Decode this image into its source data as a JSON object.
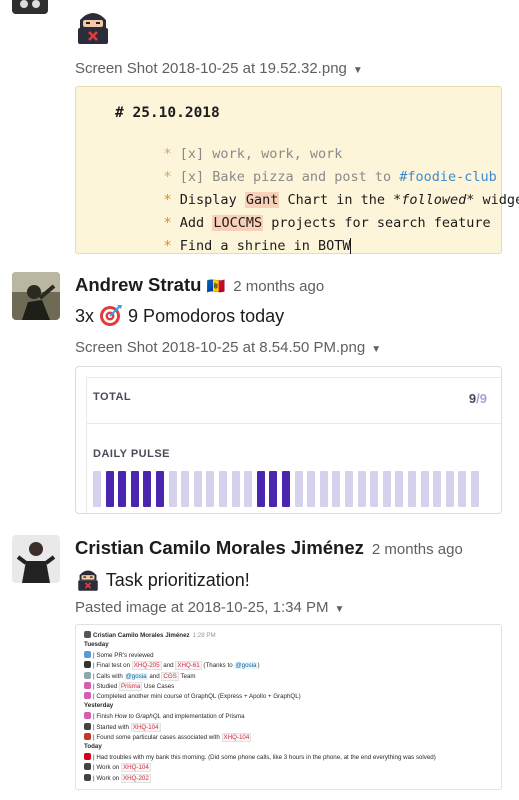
{
  "msg0": {
    "file_name": "Screen Shot 2018-10-25 at 19.52.32.png",
    "note": {
      "heading": "# 25.10.2018",
      "lines": [
        {
          "text": "[x] work, work, work",
          "done": true
        },
        {
          "prefix": "[x] Bake pizza and post to ",
          "tag": "#foodie-club",
          "done": true
        },
        {
          "before": "Display ",
          "hl": "Gant",
          "after": " Chart in the *",
          "em": "followed",
          "after2": "* widget"
        },
        {
          "before": "Add ",
          "hl": "LOCCMS",
          "after": " projects for search feature"
        },
        {
          "text": "Find a shrine in BOTW"
        }
      ],
      "bullet": "*"
    }
  },
  "msg1": {
    "user": "Andrew Stratu",
    "flag": "🇲🇩",
    "time": "2 months ago",
    "text_prefix": "3x",
    "text_emoji": "🎯",
    "text_suffix": "9 Pomodoros today",
    "file_name": "Screen Shot 2018-10-25 at 8.54.50 PM.png",
    "widget": {
      "total_label": "TOTAL",
      "total_value": "9",
      "total_sep": "/",
      "total_of": "9",
      "pulse_label": "DAILY PULSE",
      "pulse": [
        0,
        1,
        1,
        1,
        1,
        1,
        0,
        0,
        0,
        0,
        0,
        0,
        0,
        1,
        1,
        1,
        0,
        0,
        0,
        0,
        0,
        0,
        0,
        0,
        0,
        0,
        0,
        0,
        0,
        0,
        0
      ],
      "colors": {
        "on": "#4a25b0",
        "off": "#d6d2ee"
      }
    }
  },
  "msg2": {
    "user": "Cristian Camilo Morales Jiménez",
    "time": "2 months ago",
    "text": "Task prioritization!",
    "file_name": "Pasted image at 2018-10-25, 1:34 PM",
    "pasted": {
      "user": "Cristian Camilo Morales Jiménez",
      "time": "1:28 PM",
      "lines": [
        {
          "type": "sec",
          "text": "Tuesday"
        },
        {
          "icon": "#5b9bd5",
          "parts": [
            {
              "t": "| Some PR's reviewed"
            }
          ]
        },
        {
          "icon": "#333",
          "parts": [
            {
              "t": "| Final test on "
            },
            {
              "c": "XHQ-205"
            },
            {
              "t": " and "
            },
            {
              "c": "XHQ-61"
            },
            {
              "t": " (Thanks to "
            },
            {
              "m": "@gosia"
            },
            {
              "t": ")"
            }
          ]
        },
        {
          "icon": "#8aa",
          "parts": [
            {
              "t": "| Calls with "
            },
            {
              "m": "@gosia"
            },
            {
              "t": " and "
            },
            {
              "c": "CGS"
            },
            {
              "t": " Team"
            }
          ]
        },
        {
          "icon": "#d65db1",
          "parts": [
            {
              "t": "| Studied "
            },
            {
              "c": "Prisma"
            },
            {
              "t": " Use Cases"
            }
          ]
        },
        {
          "icon": "#d65db1",
          "parts": [
            {
              "t": "| Completed another mini course of GraphQL (Express + Apollo + GraphQL)"
            }
          ]
        },
        {
          "type": "sec",
          "text": "Yesterday"
        },
        {
          "icon": "#d65db1",
          "parts": [
            {
              "t": "| Finish "
            },
            {
              "i": "How to GraphQL"
            },
            {
              "t": " and implementation of Prisma"
            }
          ]
        },
        {
          "icon": "#444",
          "parts": [
            {
              "t": "| Started with "
            },
            {
              "c": "XHQ-104"
            }
          ]
        },
        {
          "icon": "#c0392b",
          "parts": [
            {
              "t": "| Found some particular cases associated with "
            },
            {
              "c": "XHQ-104"
            }
          ]
        },
        {
          "type": "sec",
          "text": "Today"
        },
        {
          "icon": "#d0021b",
          "parts": [
            {
              "t": "| Had troubles with my bank this morning. (Did some phone calls, like 3 hours in the phone, at the end everything was solved)"
            }
          ]
        },
        {
          "icon": "#444",
          "parts": [
            {
              "t": "| Work on "
            },
            {
              "c": "XHQ-104"
            }
          ]
        },
        {
          "icon": "#444",
          "parts": [
            {
              "t": "| Work on "
            },
            {
              "c": "XHQ-202"
            }
          ]
        }
      ]
    }
  }
}
